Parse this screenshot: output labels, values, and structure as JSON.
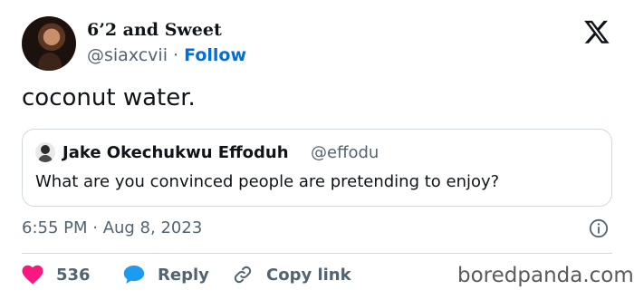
{
  "tweet": {
    "author": {
      "display_name": "6’2 and Sweet",
      "handle": "@siaxcvii",
      "separator": "·",
      "follow_label": "Follow",
      "avatar_icon": "avatar-photo"
    },
    "brand_icon": "x-logo-icon",
    "text": "coconut water.",
    "quoted": {
      "display_name": "Jake Okechukwu Effoduh",
      "handle": "@effodu",
      "text": "What are you convinced people are pretending to enjoy?"
    },
    "timestamp": "6:55 PM · Aug 8, 2023",
    "actions": {
      "like_count": "536",
      "reply_label": "Reply",
      "copy_link_label": "Copy link"
    }
  },
  "colors": {
    "link_blue": "#006fd6",
    "like_pink": "#f91880",
    "reply_blue": "#1d9bf0",
    "muted_text": "#536471",
    "border": "#cfd9de"
  },
  "watermark": "boredpanda.com"
}
